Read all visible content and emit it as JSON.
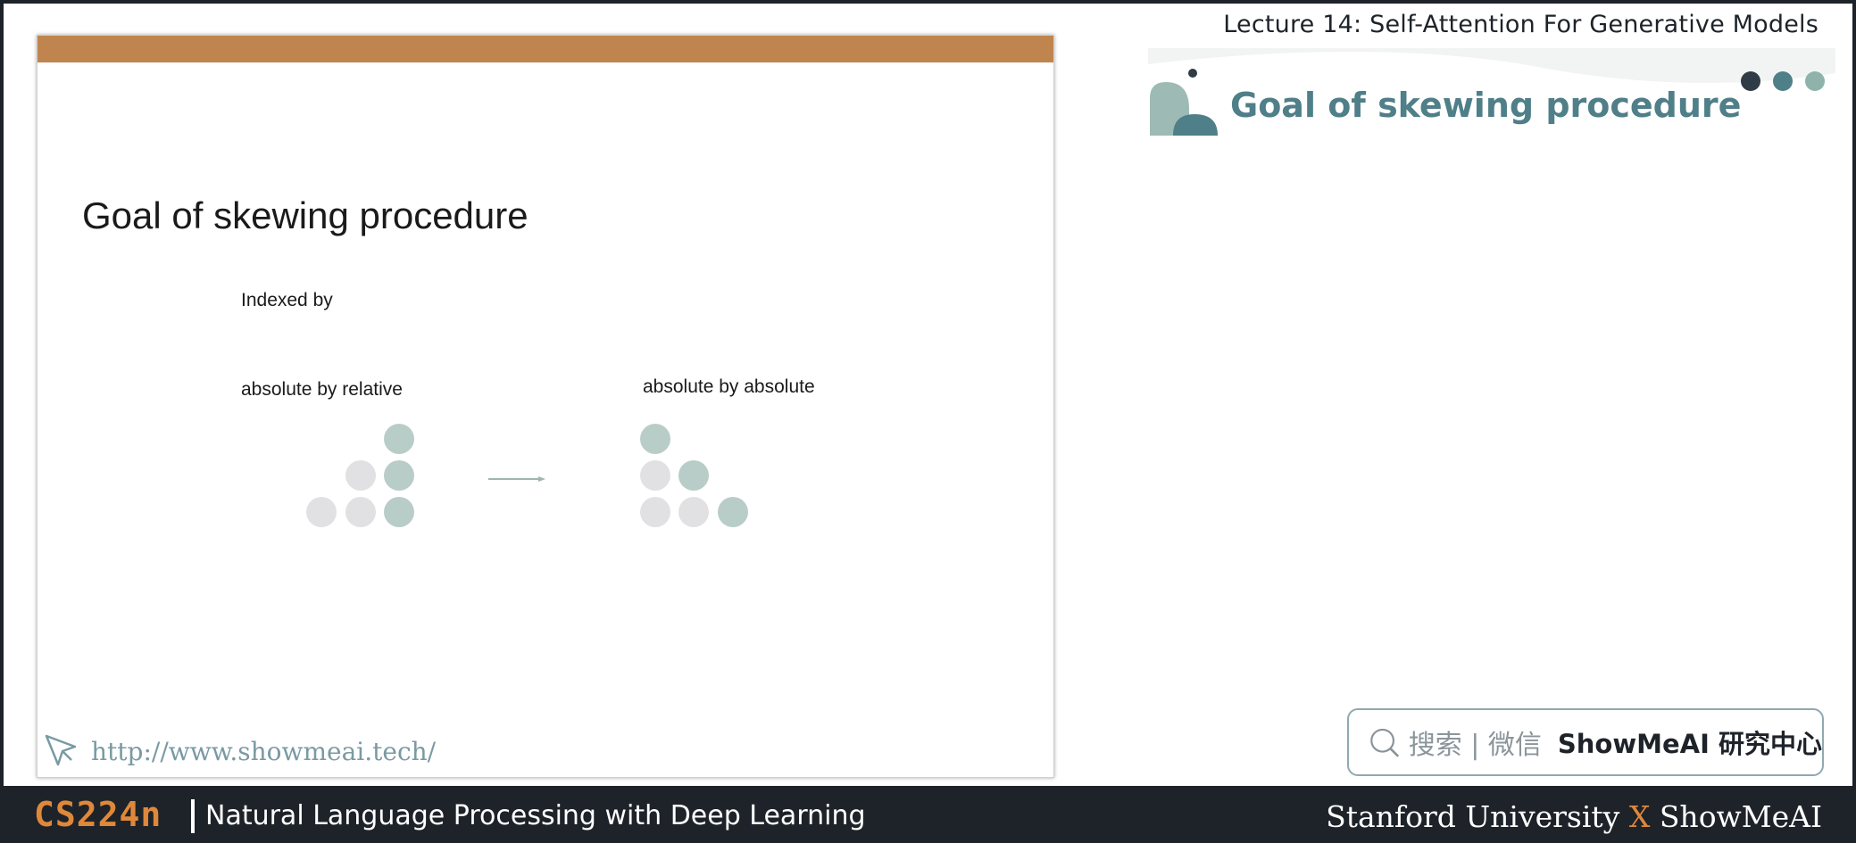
{
  "header": {
    "lecture_title": "Lecture 14:  Self-Attention For Generative Models",
    "section_title": "Goal of skewing procedure",
    "dot_colors": [
      "#2f3b45",
      "#4f7f88",
      "#8fb3ab"
    ]
  },
  "slide": {
    "accent_color": "#c0854f",
    "title": "Goal of skewing procedure",
    "indexed_label": "Indexed by",
    "left_label": "absolute by relative",
    "right_label": "absolute by absolute",
    "url": "http://www.showmeai.tech/"
  },
  "search": {
    "hint": "搜索 | 微信",
    "brand": "ShowMeAI 研究中心"
  },
  "footer": {
    "course_code": "CS224n",
    "course_name": "Natural Language Processing with Deep Learning",
    "credit_left": "Stanford University",
    "credit_x": "X",
    "credit_right": "ShowMeAI"
  }
}
